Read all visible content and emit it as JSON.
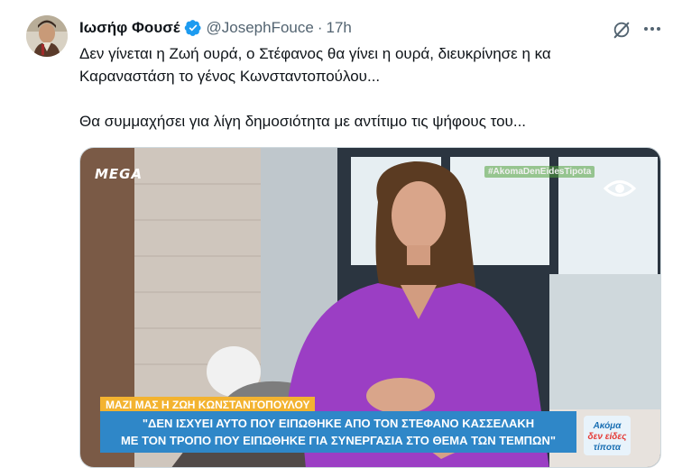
{
  "tweet": {
    "author_name": "Ιωσήφ Φουσέ",
    "handle": "@JosephFouce",
    "separator": "·",
    "time": "17h",
    "text_line1": "Δεν γίνεται η Ζωή ουρά, ο Στέφανος θα γίνει η ουρά, διευκρίνησε η κα",
    "text_line2": "Καραναστάση το γένος Κωνσταντοπούλου...",
    "text_line3": "Θα συμμαχήσει για λίγη δημοσιότητα με αντίτιμο τις ψήφους του...",
    "verified_icon": "verified-badge-icon",
    "grok_icon": "grok-icon",
    "more_icon": "more-dots-icon",
    "accent_color": "#1d9bf0"
  },
  "media": {
    "channel_logo": "ΜΕGΑ",
    "hashtag": "#AkomaDenEidesTipota",
    "lower_third_small": "ΜΑΖΙ ΜΑΣ Η ΖΩΗ ΚΩΝΣΤΑΝΤΟΠΟΥΛΟΥ",
    "lower_third_line1": "\"ΔΕΝ ΙΣΧΥΕΙ ΑΥΤΟ ΠΟΥ ΕΙΠΩΘΗΚΕ ΑΠΟ ΤΟΝ ΣΤΕΦΑΝΟ ΚΑΣΣΕΛΑΚΗ",
    "lower_third_line2": "ΜΕ ΤΟΝ ΤΡΟΠΟ ΠΟΥ ΕΙΠΩΘΗΚΕ ΓΙΑ ΣΥΝΕΡΓΑΣΙΑ ΣΤΟ ΘΕΜΑ ΤΩΝ ΤΕΜΠΩΝ\"",
    "show_logo_line1": "Ακόμα",
    "show_logo_line2": "δεν είδες",
    "show_logo_line3": "τίποτα",
    "eye_icon": "eye-logo-icon",
    "lower_third_color": "#2f87c8",
    "tag_color": "#f3b330"
  }
}
